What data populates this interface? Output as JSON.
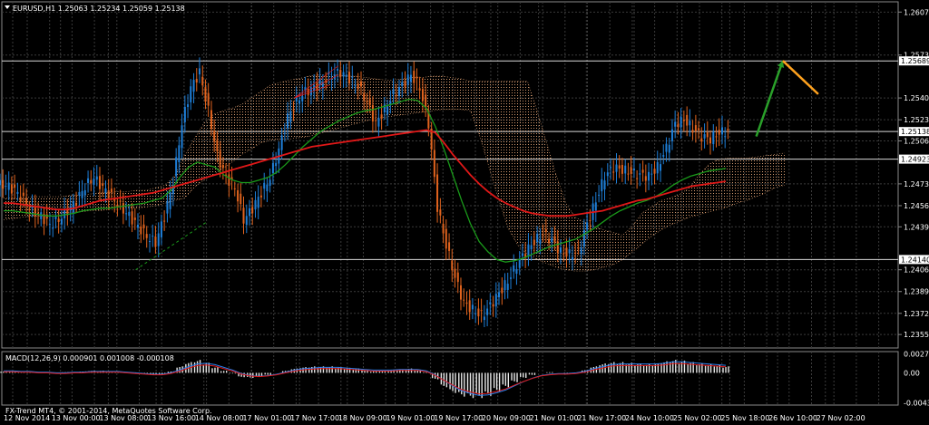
{
  "header": {
    "symbol_line": "EURUSD,H1  1.25063 1.25234 1.25059 1.25138",
    "macd_line": "MACD(12,26,9) 0.000901 0.001008 -0.000108",
    "copyright": "FX-Trend MT4, © 2001-2014, MetaQuotes Software Corp."
  },
  "colors": {
    "background": "#000000",
    "grid": "#3a3a3a",
    "bull_candle": "#1e7fd8",
    "bear_candle": "#e0631e",
    "ma_red": "#e01818",
    "ma_green": "#1a9a1a",
    "cloud": "#e8a878",
    "arrow_up": "#2aa02a",
    "arrow_down": "#ffa21e",
    "macd_hist": "#e8e8e8",
    "macd_signal_blue": "#2a7fe8",
    "macd_signal_red": "#e01818"
  },
  "chart_data": {
    "type": "line",
    "ylim": [
      1.2345,
      1.2615
    ],
    "xlim": [
      0,
      100
    ],
    "y_ticks": [
      "1.26070",
      "1.25735",
      "1.25400",
      "1.25230",
      "1.25065",
      "1.24730",
      "1.24560",
      "1.24395",
      "1.24060",
      "1.23890",
      "1.23720",
      "1.23555"
    ],
    "y_tick_values": [
      1.2607,
      1.25735,
      1.254,
      1.2523,
      1.25065,
      1.2473,
      1.2456,
      1.24395,
      1.2406,
      1.2389,
      1.2372,
      1.23555
    ],
    "price_levels": [
      {
        "label": "1.25689",
        "value": 1.25689
      },
      {
        "label": "1.25138",
        "value": 1.25138
      },
      {
        "label": "1.24923",
        "value": 1.24923
      },
      {
        "label": "1.24140",
        "value": 1.2414
      }
    ],
    "x_tick_labels": [
      "12 Nov 2014",
      "13 Nov 00:00",
      "13 Nov 08:00",
      "13 Nov 16:00",
      "14 Nov 08:00",
      "17 Nov 01:00",
      "17 Nov 17:00",
      "18 Nov 09:00",
      "19 Nov 01:00",
      "19 Nov 17:00",
      "20 Nov 09:00",
      "21 Nov 01:00",
      "21 Nov 17:00",
      "24 Nov 10:00",
      "25 Nov 02:00",
      "25 Nov 18:00",
      "26 Nov 10:00",
      "27 Nov 02:00"
    ],
    "close_series": [
      1.2472,
      1.2468,
      1.246,
      1.2452,
      1.2448,
      1.2441,
      1.2445,
      1.2452,
      1.246,
      1.2471,
      1.2478,
      1.247,
      1.2463,
      1.2455,
      1.2448,
      1.244,
      1.2432,
      1.2427,
      1.2448,
      1.2475,
      1.252,
      1.2548,
      1.256,
      1.253,
      1.2495,
      1.2478,
      1.247,
      1.2445,
      1.2454,
      1.2466,
      1.2478,
      1.25,
      1.2525,
      1.2538,
      1.2545,
      1.2548,
      1.2553,
      1.2558,
      1.256,
      1.2555,
      1.2549,
      1.2537,
      1.252,
      1.2531,
      1.2543,
      1.255,
      1.2558,
      1.2548,
      1.252,
      1.2455,
      1.2425,
      1.24,
      1.238,
      1.2375,
      1.237,
      1.2378,
      1.2388,
      1.2397,
      1.241,
      1.242,
      1.2428,
      1.2434,
      1.2429,
      1.242,
      1.2418,
      1.242,
      1.2442,
      1.246,
      1.2479,
      1.2486,
      1.2484,
      1.2482,
      1.248,
      1.2479,
      1.2486,
      1.2501,
      1.252,
      1.2523,
      1.2516,
      1.251,
      1.2508,
      1.2513,
      1.2514
    ],
    "ma_red": [
      1.2458,
      1.2458,
      1.2457,
      1.2456,
      1.2455,
      1.2454,
      1.2453,
      1.2453,
      1.2454,
      1.2456,
      1.2458,
      1.246,
      1.2461,
      1.2462,
      1.2463,
      1.2464,
      1.2465,
      1.2466,
      1.2468,
      1.247,
      1.2472,
      1.2474,
      1.2476,
      1.2478,
      1.248,
      1.2482,
      1.2484,
      1.2486,
      1.2488,
      1.249,
      1.2492,
      1.2494,
      1.2496,
      1.2498,
      1.25,
      1.2502,
      1.2503,
      1.2504,
      1.2505,
      1.2506,
      1.2507,
      1.2508,
      1.2509,
      1.251,
      1.2511,
      1.2512,
      1.2513,
      1.2514,
      1.2515,
      1.2513,
      1.2505,
      1.2496,
      1.2488,
      1.248,
      1.2473,
      1.2467,
      1.2462,
      1.2458,
      1.2455,
      1.2452,
      1.245,
      1.2449,
      1.2448,
      1.2448,
      1.2448,
      1.2449,
      1.245,
      1.2451,
      1.2452,
      1.2454,
      1.2456,
      1.2458,
      1.246,
      1.2461,
      1.2463,
      1.2465,
      1.2467,
      1.2469,
      1.2471,
      1.2472,
      1.2473,
      1.2474,
      1.2475
    ],
    "ma_green": [
      1.2452,
      1.2452,
      1.2451,
      1.245,
      1.2449,
      1.2448,
      1.2448,
      1.2449,
      1.245,
      1.2452,
      1.2453,
      1.2454,
      1.2454,
      1.2455,
      1.2456,
      1.2457,
      1.2458,
      1.246,
      1.2462,
      1.2468,
      1.2478,
      1.2486,
      1.249,
      1.2488,
      1.2486,
      1.248,
      1.2476,
      1.2474,
      1.2474,
      1.2476,
      1.2478,
      1.2482,
      1.2488,
      1.2495,
      1.2502,
      1.2508,
      1.2514,
      1.2518,
      1.2522,
      1.2525,
      1.2528,
      1.253,
      1.2531,
      1.2533,
      1.2535,
      1.2537,
      1.2539,
      1.2538,
      1.2532,
      1.2518,
      1.25,
      1.248,
      1.246,
      1.2442,
      1.2428,
      1.242,
      1.2414,
      1.2412,
      1.2413,
      1.2415,
      1.2418,
      1.2421,
      1.2424,
      1.2426,
      1.2428,
      1.243,
      1.2434,
      1.2438,
      1.2443,
      1.2448,
      1.2452,
      1.2455,
      1.2458,
      1.246,
      1.2463,
      1.2467,
      1.2472,
      1.2476,
      1.2479,
      1.2481,
      1.2483,
      1.2484,
      1.2485
    ],
    "cloud_upper": [
      1.2462,
      1.2462,
      1.2462,
      1.2463,
      1.2463,
      1.2463,
      1.2463,
      1.2464,
      1.2464,
      1.2465,
      1.2466,
      1.2466,
      1.2467,
      1.2467,
      1.2468,
      1.2468,
      1.247,
      1.2472,
      1.248,
      1.2495,
      1.2508,
      1.252,
      1.2527,
      1.253,
      1.2532,
      1.2535,
      1.254,
      1.2545,
      1.255,
      1.2552,
      1.2554,
      1.2555,
      1.2557,
      1.2558,
      1.2558,
      1.2558,
      1.2557,
      1.2557,
      1.2556,
      1.2555,
      1.2554,
      1.2554,
      1.2555,
      1.2556,
      1.2556,
      1.2557,
      1.2557,
      1.2556,
      1.2555,
      1.2553,
      1.2553,
      1.2553,
      1.2553,
      1.2553,
      1.2553,
      1.2553,
      1.253,
      1.2505,
      1.248,
      1.2458,
      1.2447,
      1.2443,
      1.244,
      1.2437,
      1.2435,
      1.2433,
      1.244,
      1.245,
      1.2455,
      1.246,
      1.2462,
      1.2465,
      1.247,
      1.248,
      1.2488,
      1.2492,
      1.2493,
      1.2493,
      1.2493,
      1.2494,
      1.2495,
      1.2496,
      1.2497
    ],
    "cloud_lower": [
      1.2445,
      1.2446,
      1.2447,
      1.2448,
      1.2448,
      1.2449,
      1.245,
      1.2451,
      1.2451,
      1.2452,
      1.2452,
      1.2453,
      1.2453,
      1.2454,
      1.2454,
      1.2455,
      1.2456,
      1.2458,
      1.246,
      1.2462,
      1.247,
      1.2476,
      1.248,
      1.2485,
      1.249,
      1.2496,
      1.25,
      1.2505,
      1.2507,
      1.2508,
      1.2508,
      1.2509,
      1.251,
      1.2512,
      1.2514,
      1.2516,
      1.2518,
      1.252,
      1.2522,
      1.2524,
      1.2525,
      1.2526,
      1.2527,
      1.2528,
      1.2529,
      1.253,
      1.2531,
      1.2531,
      1.2531,
      1.253,
      1.251,
      1.2485,
      1.246,
      1.2438,
      1.2425,
      1.2418,
      1.2414,
      1.2411,
      1.2408,
      1.2406,
      1.2405,
      1.2405,
      1.2406,
      1.2408,
      1.241,
      1.2414,
      1.242,
      1.2426,
      1.2432,
      1.2437,
      1.2441,
      1.2444,
      1.2447,
      1.2449,
      1.2451,
      1.2453,
      1.2455,
      1.2458,
      1.246,
      1.2463,
      1.2466,
      1.247,
      1.2472
    ],
    "forecast_arrows": [
      {
        "from": [
          85,
          1.251
        ],
        "to": [
          88,
          1.2569
        ],
        "color": "arrow_up"
      },
      {
        "from": [
          88,
          1.2569
        ],
        "to": [
          92,
          1.2543
        ],
        "color": "arrow_down"
      }
    ],
    "macd": {
      "ylim": [
        -0.0047,
        0.0031
      ],
      "y_ticks": [
        "0.002797",
        "0.00",
        "-0.004397"
      ],
      "y_tick_values": [
        0.0028,
        0.0,
        -0.0044
      ],
      "histogram": [
        0.0002,
        0.0002,
        0.0001,
        0.0001,
        0.0001,
        0.0,
        0.0,
        0.0001,
        0.0001,
        0.0002,
        0.0003,
        0.0003,
        0.0002,
        0.0001,
        0.0,
        -0.0001,
        -0.0002,
        -0.0003,
        -0.0002,
        0.0002,
        0.0009,
        0.0015,
        0.0018,
        0.0014,
        0.0008,
        0.0003,
        -0.0001,
        -0.0006,
        -0.0007,
        -0.0005,
        -0.0003,
        0.0,
        0.0003,
        0.0006,
        0.0008,
        0.0009,
        0.0009,
        0.0009,
        0.0008,
        0.0007,
        0.0006,
        0.0004,
        0.0002,
        0.0003,
        0.0004,
        0.0005,
        0.0006,
        0.0004,
        0.0001,
        -0.0009,
        -0.002,
        -0.0028,
        -0.0033,
        -0.0035,
        -0.0035,
        -0.0032,
        -0.0026,
        -0.002,
        -0.0013,
        -0.0007,
        -0.0003,
        0.0,
        0.0001,
        0.0,
        -0.0001,
        0.0,
        0.0004,
        0.0009,
        0.0013,
        0.0015,
        0.0015,
        0.0014,
        0.0013,
        0.0012,
        0.0013,
        0.0016,
        0.0018,
        0.0017,
        0.0015,
        0.0013,
        0.0012,
        0.0011,
        0.0009
      ],
      "signal": [
        0.0003,
        0.0003,
        0.0002,
        0.0002,
        0.0001,
        0.0001,
        0.0,
        0.0,
        0.0001,
        0.0001,
        0.0002,
        0.0002,
        0.0002,
        0.0002,
        0.0001,
        0.0,
        -0.0001,
        -0.0002,
        -0.0002,
        0.0,
        0.0004,
        0.0009,
        0.0013,
        0.0014,
        0.0012,
        0.0008,
        0.0004,
        -0.0001,
        -0.0004,
        -0.0005,
        -0.0004,
        -0.0002,
        0.0001,
        0.0004,
        0.0006,
        0.0007,
        0.0008,
        0.0008,
        0.0008,
        0.0007,
        0.0006,
        0.0005,
        0.0004,
        0.0004,
        0.0004,
        0.0005,
        0.0005,
        0.0005,
        0.0003,
        -0.0003,
        -0.0011,
        -0.0019,
        -0.0026,
        -0.003,
        -0.0033,
        -0.0032,
        -0.0029,
        -0.0025,
        -0.0019,
        -0.0013,
        -0.0008,
        -0.0004,
        -0.0002,
        -0.0001,
        -0.0001,
        0.0,
        0.0002,
        0.0006,
        0.0009,
        0.0012,
        0.0013,
        0.0013,
        0.0013,
        0.0013,
        0.0013,
        0.0014,
        0.0016,
        0.0016,
        0.0015,
        0.0014,
        0.0013,
        0.0012,
        0.0011
      ]
    }
  }
}
